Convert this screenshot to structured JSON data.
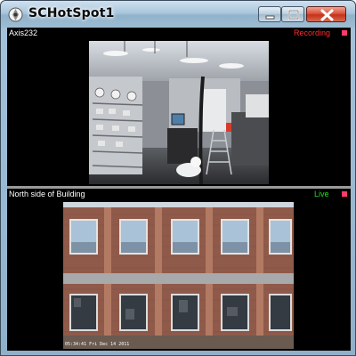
{
  "window": {
    "title": "SCHotSpot1",
    "icon": "camera-app-icon",
    "controls": [
      "minimize-icon",
      "maximize-icon",
      "close-icon"
    ]
  },
  "cameras": [
    {
      "name": "Axis232",
      "status": "Recording",
      "status_color": "#ff2a2a",
      "indicator_color": "#ff3b6b",
      "scene": "lab-room-feed"
    },
    {
      "name": "North side of Building",
      "status": "Live",
      "status_color": "#27d827",
      "indicator_color": "#ff3b6b",
      "scene": "brick-building-feed",
      "timestamp": "05:34:41 Fri Dec 14 2011"
    }
  ]
}
